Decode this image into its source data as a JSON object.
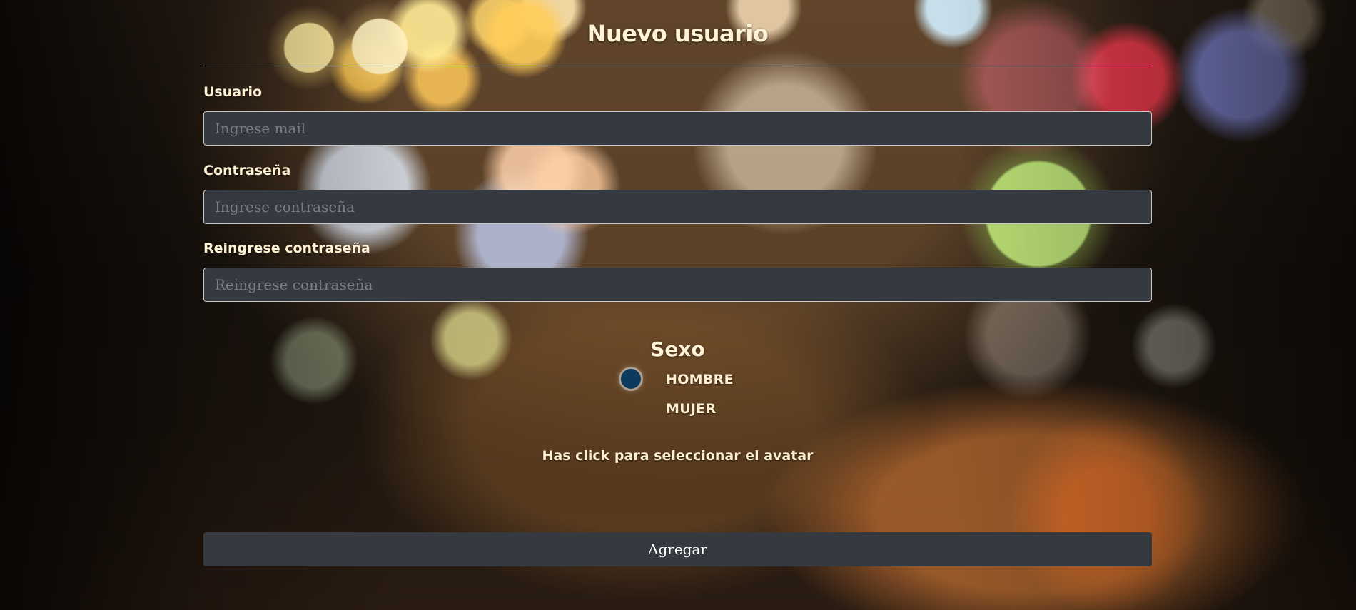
{
  "page": {
    "title": "Nuevo usuario"
  },
  "fields": {
    "usuario": {
      "label": "Usuario",
      "placeholder": "Ingrese mail",
      "value": ""
    },
    "contrasena": {
      "label": "Contraseña",
      "placeholder": "Ingrese contraseña",
      "value": ""
    },
    "reingrese": {
      "label": "Reingrese contraseña",
      "placeholder": "Reingrese contraseña",
      "value": ""
    }
  },
  "sexo": {
    "title": "Sexo",
    "options": [
      {
        "label": "HOMBRE",
        "selected": true
      },
      {
        "label": "MUJER",
        "selected": false
      }
    ]
  },
  "avatar": {
    "prompt": "Has click para seleccionar el avatar"
  },
  "submit": {
    "label": "Agregar"
  },
  "colors": {
    "input_bg": "#343a40",
    "text_cream": "#fff0d2",
    "radio_selected": "#0d3b5e"
  }
}
